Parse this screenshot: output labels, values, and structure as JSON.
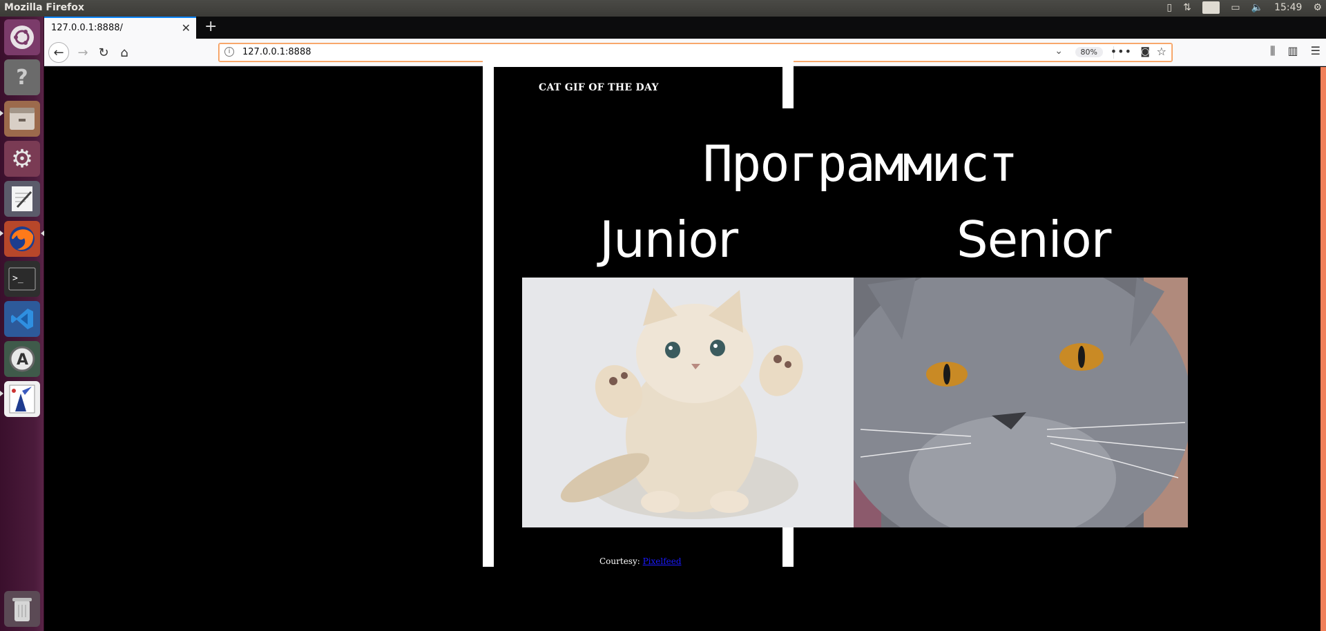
{
  "system_bar": {
    "app_title": "Mozilla Firefox",
    "keyboard_layout": "En",
    "clock": "15:49"
  },
  "browser": {
    "tab_title": "127.0.0.1:8888/",
    "url": "127.0.0.1:8888",
    "zoom": "80%"
  },
  "page": {
    "header": "CAT GIF OF THE DAY",
    "heading": "Программист",
    "left_label": "Junior",
    "right_label": "Senior",
    "courtesy_label": "Courtesy:",
    "courtesy_link": "Pixelfeed"
  },
  "colors": {
    "launcher_bg": "#4b1b3b",
    "url_focus_border": "#f19d5c",
    "scrollbar": "#f0805a"
  }
}
